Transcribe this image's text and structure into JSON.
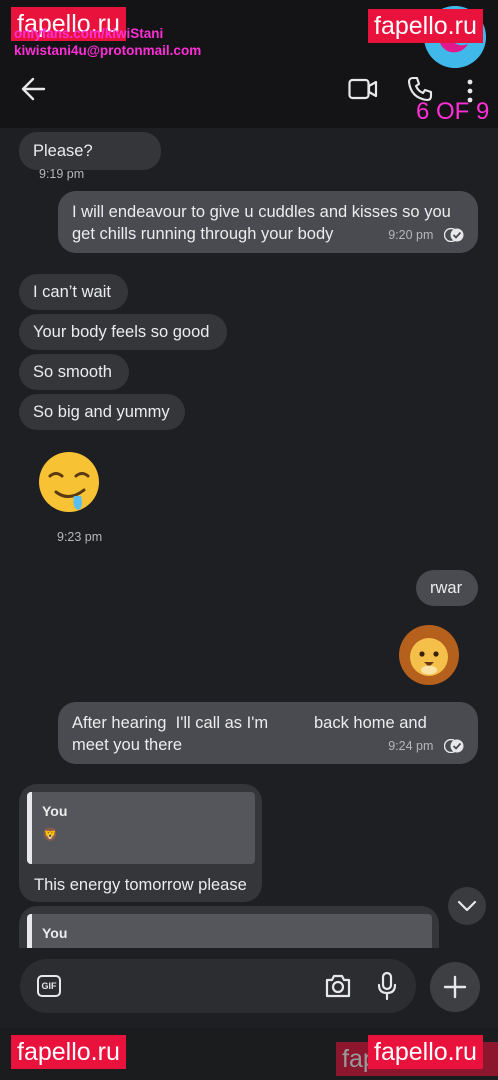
{
  "watermarks": {
    "site": "fapello.ru"
  },
  "header": {
    "handle_line1": "onlyfans.com/kiwiStani",
    "handle_line2": "kiwistani4u@protonmail.com",
    "counter": "6 OF 9",
    "icons": [
      "back-arrow-icon",
      "video-call-icon",
      "phone-icon",
      "more-options-icon"
    ]
  },
  "messages": [
    {
      "dir": "in",
      "text": "Please?",
      "time": "9:19 pm"
    },
    {
      "dir": "out",
      "line1": "I will endeavour to give u cuddles and kisses so you",
      "line2": "get chills running through your body",
      "time": "9:20 pm",
      "status": "read"
    },
    {
      "dir": "in",
      "text": "I can’t wait"
    },
    {
      "dir": "in",
      "text": "Your body feels so good"
    },
    {
      "dir": "in",
      "text": "So smooth"
    },
    {
      "dir": "in",
      "text": "So big and yummy"
    },
    {
      "dir": "in",
      "type": "emoji",
      "emoji": "drooling-face",
      "time": "9:23 pm"
    },
    {
      "dir": "out",
      "text": "rwar"
    },
    {
      "dir": "out",
      "type": "emoji",
      "emoji": "lion-face"
    },
    {
      "dir": "out",
      "line1": "After hearing  I'll call as I'm          back home and",
      "line2": "meet you there",
      "time": "9:24 pm",
      "status": "read"
    },
    {
      "dir": "in",
      "quote_author": "You",
      "quote_emoji": "🦁",
      "text": "This energy tomorrow please"
    },
    {
      "dir": "in",
      "quote_author": "You"
    }
  ],
  "composer": {
    "gif_label": "GIF",
    "icons": [
      "gif-icon",
      "camera-icon",
      "microphone-icon",
      "plus-icon"
    ]
  },
  "colors": {
    "background": "#1e1f22",
    "incoming": "#35363a",
    "outgoing": "#4a4b50",
    "watermark": "#e8123c",
    "overlay_text": "#ff2fd6"
  }
}
